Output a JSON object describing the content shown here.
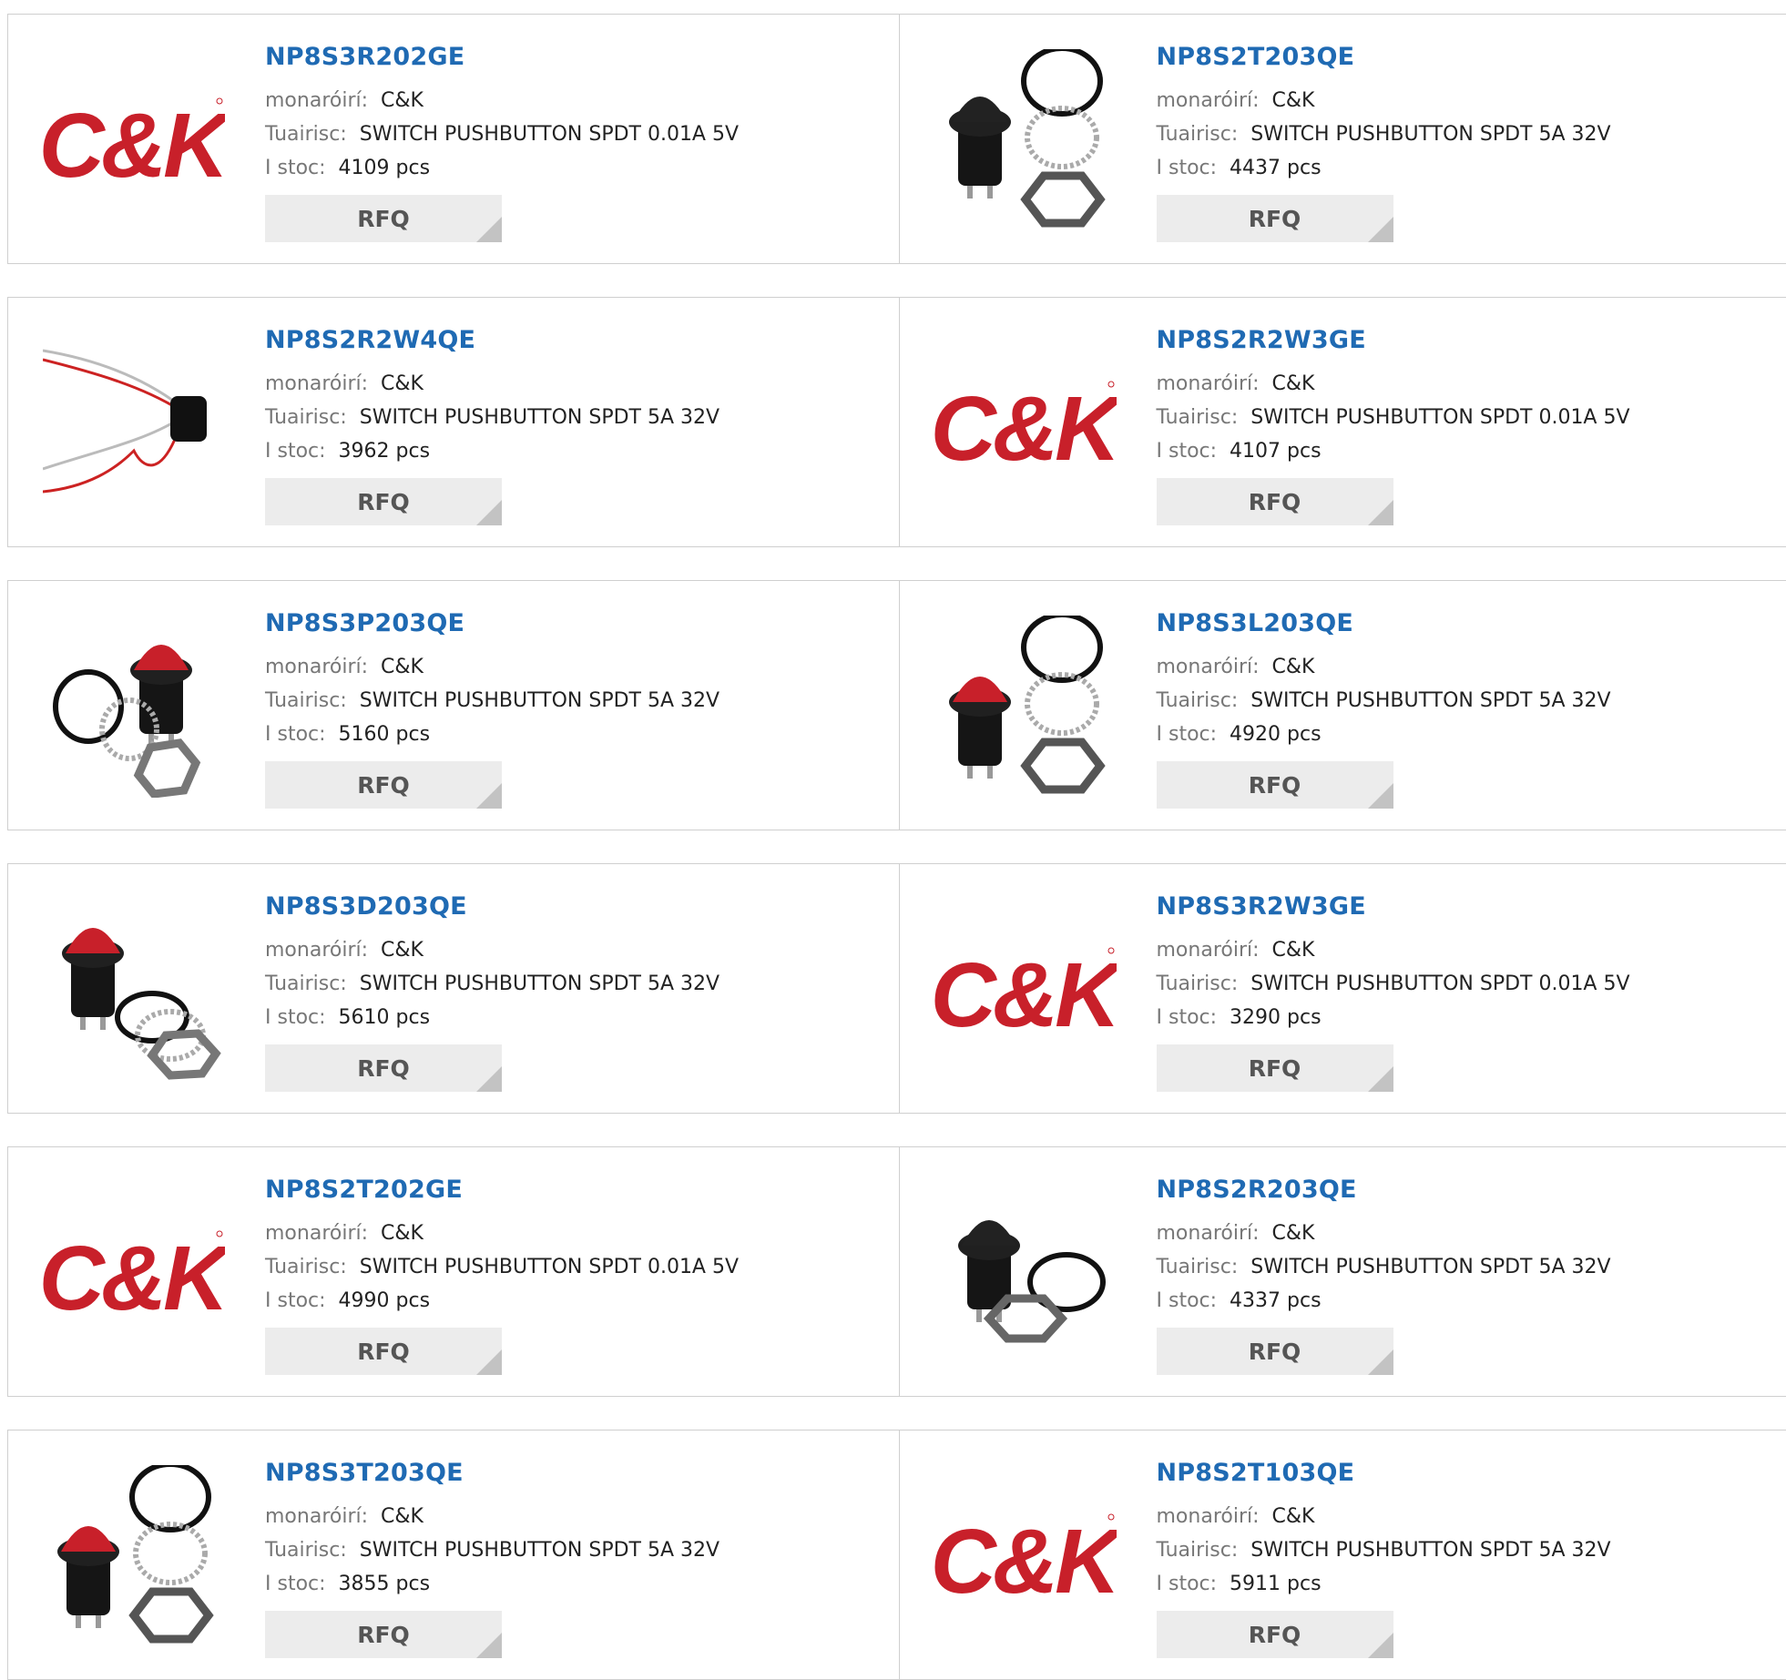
{
  "labels": {
    "manufacturer": "monaróirí:",
    "description": "Tuairisc:",
    "stock": "I stoc:",
    "rfq": "RFQ"
  },
  "products": [
    {
      "pn": "NP8S3R202GE",
      "manufacturer": "C&K",
      "description": "SWITCH PUSHBUTTON SPDT 0.01A 5V",
      "stock": "4109 pcs",
      "image": "ck-logo"
    },
    {
      "pn": "NP8S2T203QE",
      "manufacturer": "C&K",
      "description": "SWITCH PUSHBUTTON SPDT 5A 32V",
      "stock": "4437 pcs",
      "image": "switch-black-with-hardware"
    },
    {
      "pn": "NP8S2R2W4QE",
      "manufacturer": "C&K",
      "description": "SWITCH PUSHBUTTON SPDT 5A 32V",
      "stock": "3962 pcs",
      "image": "switch-with-wires"
    },
    {
      "pn": "NP8S2R2W3GE",
      "manufacturer": "C&K",
      "description": "SWITCH PUSHBUTTON SPDT 0.01A 5V",
      "stock": "4107 pcs",
      "image": "ck-logo"
    },
    {
      "pn": "NP8S3P203QE",
      "manufacturer": "C&K",
      "description": "SWITCH PUSHBUTTON SPDT 5A 32V",
      "stock": "5160 pcs",
      "image": "switch-red-tilted-with-hardware"
    },
    {
      "pn": "NP8S3L203QE",
      "manufacturer": "C&K",
      "description": "SWITCH PUSHBUTTON SPDT 5A 32V",
      "stock": "4920 pcs",
      "image": "switch-red-with-hardware"
    },
    {
      "pn": "NP8S3D203QE",
      "manufacturer": "C&K",
      "description": "SWITCH PUSHBUTTON SPDT 5A 32V",
      "stock": "5610 pcs",
      "image": "switch-red-dome-with-hardware"
    },
    {
      "pn": "NP8S3R2W3GE",
      "manufacturer": "C&K",
      "description": "SWITCH PUSHBUTTON SPDT 0.01A 5V",
      "stock": "3290 pcs",
      "image": "ck-logo"
    },
    {
      "pn": "NP8S2T202GE",
      "manufacturer": "C&K",
      "description": "SWITCH PUSHBUTTON SPDT 0.01A 5V",
      "stock": "4990 pcs",
      "image": "ck-logo"
    },
    {
      "pn": "NP8S2R203QE",
      "manufacturer": "C&K",
      "description": "SWITCH PUSHBUTTON SPDT 5A 32V",
      "stock": "4337 pcs",
      "image": "switch-black-small-with-hardware"
    },
    {
      "pn": "NP8S3T203QE",
      "manufacturer": "C&K",
      "description": "SWITCH PUSHBUTTON SPDT 5A 32V",
      "stock": "3855 pcs",
      "image": "switch-red-with-hardware"
    },
    {
      "pn": "NP8S2T103QE",
      "manufacturer": "C&K",
      "description": "SWITCH PUSHBUTTON SPDT 5A 32V",
      "stock": "5911 pcs",
      "image": "ck-logo"
    }
  ],
  "brand": {
    "logo_text": "C&K",
    "logo_color": "#c8202a",
    "link_color": "#1f6ab3",
    "button_bg": "#ececec"
  }
}
